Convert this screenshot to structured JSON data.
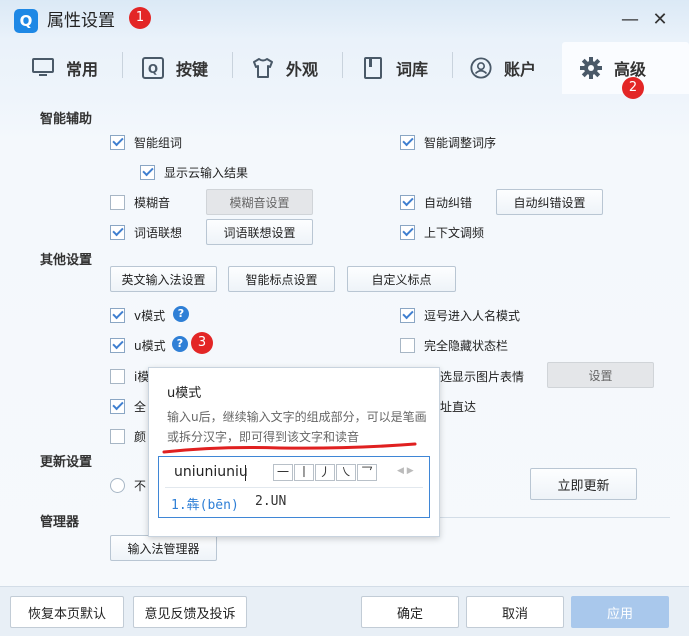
{
  "window": {
    "title": "属性设置",
    "icon": "Q",
    "minimize": "—",
    "close": "✕"
  },
  "badges": {
    "b1": "1",
    "b2": "2",
    "b3": "3"
  },
  "tabs": [
    {
      "label": "常用",
      "icon": "monitor-icon"
    },
    {
      "label": "按键",
      "icon": "q-key-icon"
    },
    {
      "label": "外观",
      "icon": "tshirt-icon"
    },
    {
      "label": "词库",
      "icon": "book-icon"
    },
    {
      "label": "账户",
      "icon": "user-icon"
    },
    {
      "label": "高级",
      "icon": "gear-icon"
    }
  ],
  "sections": {
    "assist": "智能辅助",
    "other": "其他设置",
    "update": "更新设置",
    "manager": "管理器"
  },
  "assist": {
    "smart_group": "智能组词",
    "smart_order": "智能调整词序",
    "show_cloud": "显示云输入结果",
    "fuzzy": "模糊音",
    "fuzzy_btn": "模糊音设置",
    "autocorrect": "自动纠错",
    "autocorrect_btn": "自动纠错设置",
    "assoc": "词语联想",
    "assoc_btn": "词语联想设置",
    "context": "上下文调频"
  },
  "other": {
    "en_btn": "英文输入法设置",
    "punct_btn": "智能标点设置",
    "custom_punct_btn": "自定义标点",
    "v_mode": "v模式",
    "comma_name": "逗号进入人名模式",
    "u_mode": "u模式",
    "hide_status": "完全隐藏状态栏",
    "i_mode": "i模",
    "img_emoji": "选显示图片表情",
    "settings_btn": "设置",
    "full": "全",
    "url_direct": "址直达",
    "color": "颜"
  },
  "update": {
    "radio_label": "不",
    "update_now": "立即更新"
  },
  "manager": {
    "btn": "输入法管理器"
  },
  "tooltip": {
    "title": "u模式",
    "desc": "输入u后，继续输入文字的组成部分，可以是笔画或拆分汉字，即可得到该文字和读音",
    "input": "uniuniuniu",
    "strokes": [
      "一",
      "丨",
      "丿",
      "㇏",
      "乛"
    ],
    "arrows": "◀ ▶",
    "cand1": "1.犇(bēn)",
    "cand2": "2.UN"
  },
  "footer": {
    "restore": "恢复本页默认",
    "feedback": "意见反馈及投诉",
    "ok": "确定",
    "cancel": "取消",
    "apply": "应用"
  },
  "colors": {
    "accent": "#3f86d6",
    "badge": "#e32626",
    "underline": "#e02020"
  }
}
